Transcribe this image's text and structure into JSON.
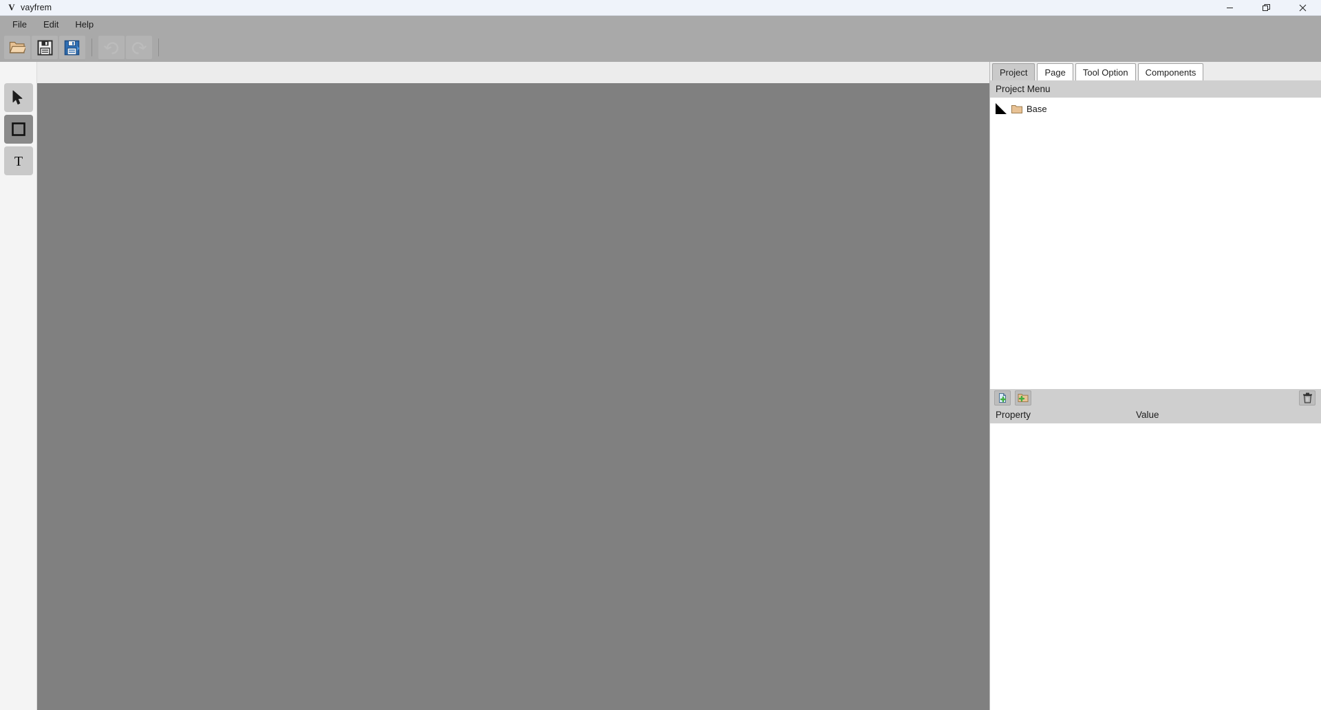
{
  "window": {
    "logo": "V",
    "title": "vayfrem",
    "controls": [
      {
        "name": "minimize",
        "glyph": "minimize-icon"
      },
      {
        "name": "maximize",
        "glyph": "restore-icon"
      },
      {
        "name": "close",
        "glyph": "close-icon"
      }
    ]
  },
  "menubar": {
    "items": [
      {
        "label": "File"
      },
      {
        "label": "Edit"
      },
      {
        "label": "Help"
      }
    ]
  },
  "toolbar": {
    "buttons": [
      {
        "name": "open-folder-icon",
        "tooltip": "Open"
      },
      {
        "name": "save-icon",
        "tooltip": "Save"
      },
      {
        "name": "save-as-icon",
        "tooltip": "Save As"
      },
      {
        "name": "undo-icon",
        "tooltip": "Undo",
        "disabled": true
      },
      {
        "name": "redo-icon",
        "tooltip": "Redo",
        "disabled": true
      }
    ]
  },
  "tools": {
    "items": [
      {
        "name": "select-tool",
        "icon": "cursor-icon",
        "state": "light"
      },
      {
        "name": "rectangle-tool",
        "icon": "square-icon",
        "state": "dark"
      },
      {
        "name": "text-tool",
        "icon": "text-icon",
        "state": "light",
        "glyph": "T"
      }
    ]
  },
  "canvas": {
    "background_color": "#808080"
  },
  "right_panel": {
    "tabs": [
      {
        "label": "Project",
        "active": true
      },
      {
        "label": "Page",
        "active": false
      },
      {
        "label": "Tool Option",
        "active": false
      },
      {
        "label": "Components",
        "active": false
      }
    ],
    "project_menu": {
      "header": "Project Menu",
      "tree": [
        {
          "label": "Base",
          "icon": "folder-icon",
          "expanded": true
        }
      ]
    },
    "property_toolbar": {
      "buttons": [
        {
          "name": "add-page-button",
          "icon": "file-plus-icon"
        },
        {
          "name": "add-folder-button",
          "icon": "folder-plus-icon"
        },
        {
          "name": "delete-button",
          "icon": "trash-icon"
        }
      ]
    },
    "property_table": {
      "columns": [
        {
          "label": "Property"
        },
        {
          "label": "Value"
        }
      ],
      "rows": []
    }
  },
  "colors": {
    "titlebar": "#eff3fa",
    "menubar": "#a9a9a9",
    "toolbar": "#a9a9a9",
    "panel": "#cfcfcf",
    "canvas": "#808080",
    "accent_green": "#3fae3f",
    "folder": "#e8c295"
  }
}
